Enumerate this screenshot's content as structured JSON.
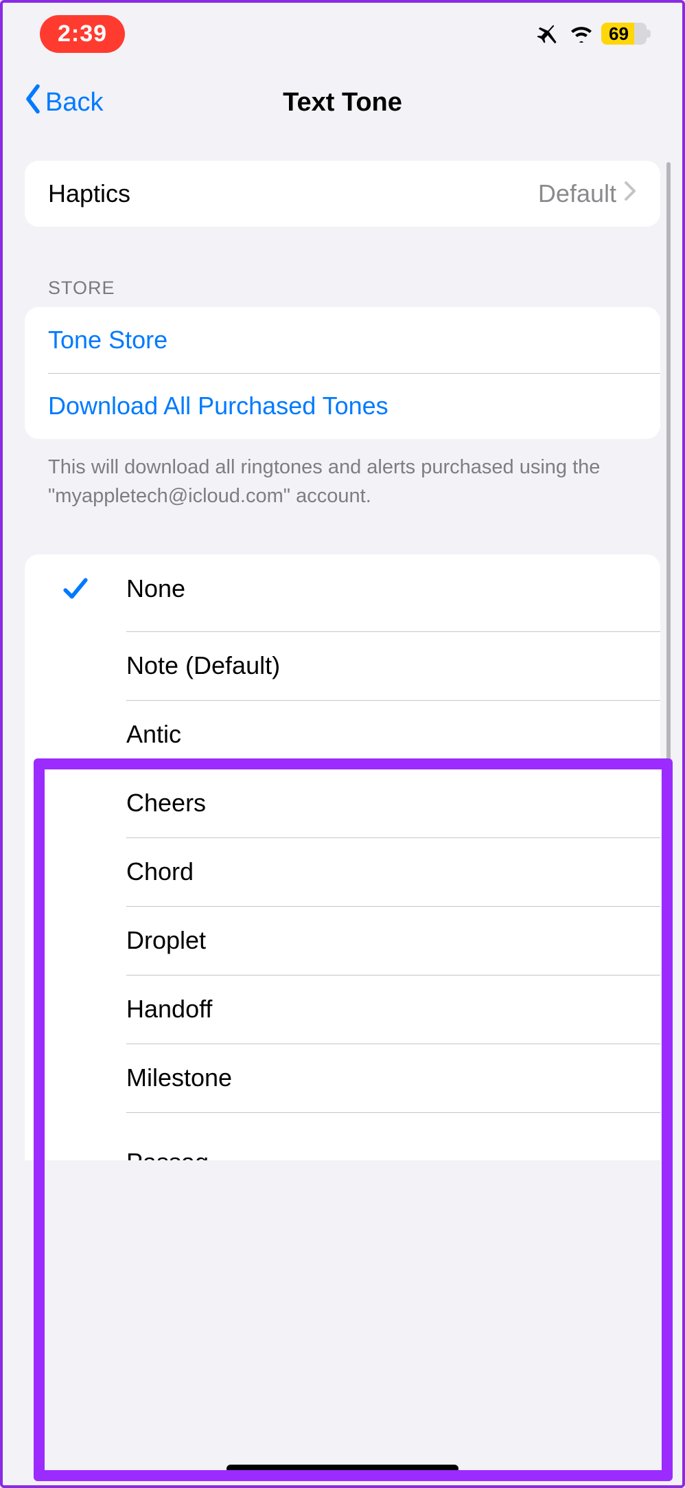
{
  "status": {
    "time": "2:39",
    "battery": "69"
  },
  "nav": {
    "back": "Back",
    "title": "Text Tone"
  },
  "haptics": {
    "label": "Haptics",
    "value": "Default"
  },
  "store": {
    "header": "STORE",
    "tone_store": "Tone Store",
    "download_all": "Download All Purchased Tones",
    "footer": "This will download all ringtones and alerts purchased using the \"myappletech@icloud.com\" account."
  },
  "tones": {
    "selected": "None",
    "items": [
      "None",
      "Note (Default)",
      "Antic",
      "Cheers",
      "Chord",
      "Droplet",
      "Handoff",
      "Milestone",
      "Passag"
    ]
  }
}
